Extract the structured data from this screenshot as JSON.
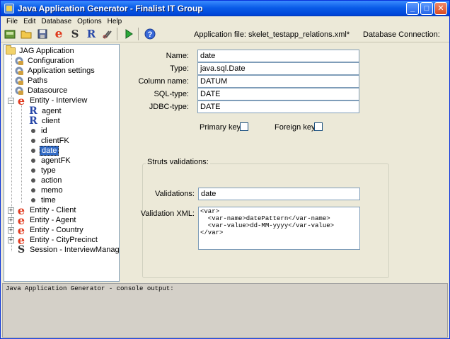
{
  "window": {
    "title": "Java Application Generator - Finalist IT Group"
  },
  "menu": [
    "File",
    "Edit",
    "Database",
    "Options",
    "Help"
  ],
  "toolbar": {
    "buttons": [
      {
        "name": "new-icon",
        "glyph": "▣"
      },
      {
        "name": "open-folder-icon",
        "glyph": ""
      },
      {
        "name": "save-icon",
        "glyph": "▤"
      },
      {
        "name": "entity-icon",
        "glyph": "e"
      },
      {
        "name": "session-icon",
        "glyph": "S"
      },
      {
        "name": "relation-icon",
        "glyph": "R"
      },
      {
        "name": "build-icon",
        "glyph": "✂"
      },
      {
        "name": "run-icon",
        "glyph": "▶"
      },
      {
        "name": "help-icon",
        "glyph": "?"
      }
    ],
    "app_file": "Application file: skelet_testapp_relations.xml*",
    "db_connection": "Database Connection:"
  },
  "tree": {
    "root": "JAG Application",
    "items": [
      {
        "label": "Configuration",
        "icon": "gear-icon"
      },
      {
        "label": "Application settings",
        "icon": "gear-icon"
      },
      {
        "label": "Paths",
        "icon": "gear-icon"
      },
      {
        "label": "Datasource",
        "icon": "gear-icon"
      },
      {
        "label": "Entity - Interview",
        "icon": "entity-icon",
        "expanded": true
      },
      {
        "label": "agent",
        "icon": "relation-icon"
      },
      {
        "label": "client",
        "icon": "relation-icon"
      },
      {
        "label": "id",
        "icon": "field-icon"
      },
      {
        "label": "clientFK",
        "icon": "field-icon"
      },
      {
        "label": "date",
        "icon": "field-icon",
        "selected": true
      },
      {
        "label": "agentFK",
        "icon": "field-icon"
      },
      {
        "label": "type",
        "icon": "field-icon"
      },
      {
        "label": "action",
        "icon": "field-icon"
      },
      {
        "label": "memo",
        "icon": "field-icon"
      },
      {
        "label": "time",
        "icon": "field-icon"
      },
      {
        "label": "Entity - Client",
        "icon": "entity-icon"
      },
      {
        "label": "Entity - Agent",
        "icon": "entity-icon"
      },
      {
        "label": "Entity - Country",
        "icon": "entity-icon"
      },
      {
        "label": "Entity - CityPrecinct",
        "icon": "entity-icon"
      },
      {
        "label": "Session - InterviewManager",
        "icon": "session-icon"
      }
    ]
  },
  "form": {
    "name_label": "Name:",
    "name_value": "date",
    "type_label": "Type:",
    "type_value": "java.sql.Date",
    "column_label": "Column name:",
    "column_value": "DATUM",
    "sqltype_label": "SQL-type:",
    "sqltype_value": "DATE",
    "jdbctype_label": "JDBC-type:",
    "jdbctype_value": "DATE",
    "primary_key_label": "Primary key:",
    "foreign_key_label": "Foreign key:",
    "struts_title": "Struts validations:",
    "validations_label": "Validations:",
    "validations_value": "date",
    "validation_xml_label": "Validation XML:",
    "validation_xml_value": "<var>\n  <var-name>datePattern</var-name>\n  <var-value>dd-MM-yyyy</var-value>\n</var>"
  },
  "console": {
    "text": "Java Application Generator - console output:"
  }
}
